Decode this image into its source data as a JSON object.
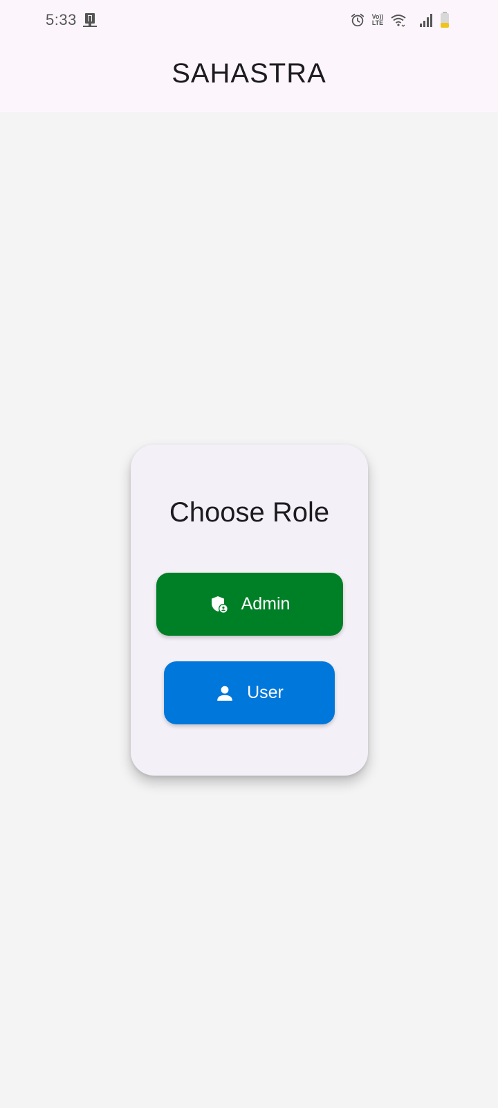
{
  "status_bar": {
    "time": "5:33",
    "left_icon": "notification-app-icon",
    "right_icons": [
      "alarm-icon",
      "volte-icon",
      "wifi-icon",
      "signal-icon",
      "battery-icon"
    ],
    "volte_top": "Vo))",
    "volte_bottom": "LTE"
  },
  "app_bar": {
    "title": "SAHASTRA"
  },
  "role_card": {
    "title": "Choose Role",
    "admin_button": {
      "label": "Admin",
      "icon": "admin-shield-icon",
      "color": "#008026"
    },
    "user_button": {
      "label": "User",
      "icon": "person-icon",
      "color": "#0077db"
    }
  },
  "colors": {
    "background": "#f4f4f5",
    "app_bar": "#fcf6fc",
    "card": "#f4f0f7",
    "text": "#1d1b20",
    "battery_level": "#f0c419"
  }
}
